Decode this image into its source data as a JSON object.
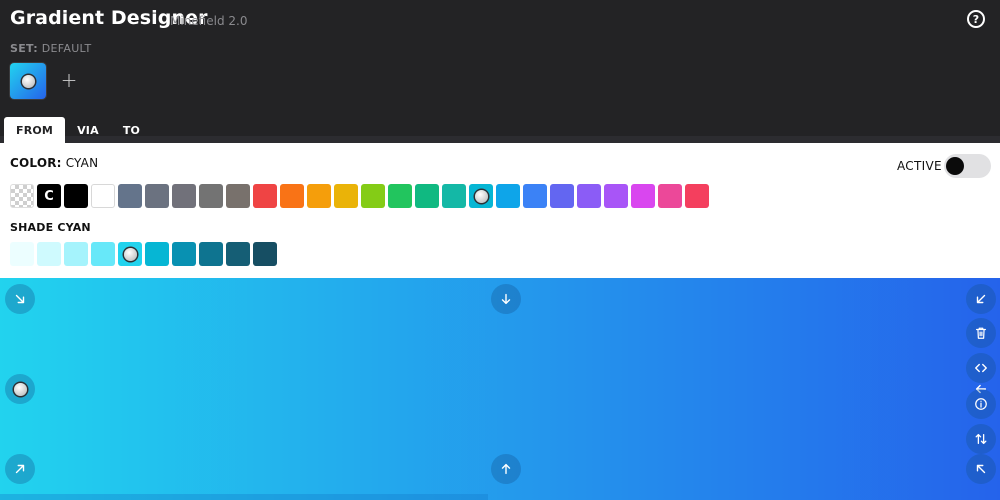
{
  "app": {
    "title": "Gradient Designer",
    "version": "Minefield 2.0"
  },
  "set": {
    "label": "SET:",
    "name": "DEFAULT"
  },
  "tabs": [
    {
      "label": "FROM",
      "active": true
    },
    {
      "label": "VIA",
      "active": false
    },
    {
      "label": "TO",
      "active": false
    }
  ],
  "color": {
    "label": "COLOR:",
    "name": "CYAN"
  },
  "active_toggle": {
    "label": "ACTIVE",
    "on": false
  },
  "palette": [
    {
      "name": "transparent",
      "hex": ""
    },
    {
      "name": "current",
      "hex": "#000000",
      "text": "C"
    },
    {
      "name": "black",
      "hex": "#000000"
    },
    {
      "name": "white",
      "hex": "#ffffff"
    },
    {
      "name": "slate",
      "hex": "#64748b"
    },
    {
      "name": "gray",
      "hex": "#6b7280"
    },
    {
      "name": "zinc",
      "hex": "#71717a"
    },
    {
      "name": "neutral",
      "hex": "#737373"
    },
    {
      "name": "stone",
      "hex": "#78716c"
    },
    {
      "name": "red",
      "hex": "#ef4444"
    },
    {
      "name": "orange",
      "hex": "#f97316"
    },
    {
      "name": "amber",
      "hex": "#f59e0b"
    },
    {
      "name": "yellow",
      "hex": "#eab308"
    },
    {
      "name": "lime",
      "hex": "#84cc16"
    },
    {
      "name": "green",
      "hex": "#22c55e"
    },
    {
      "name": "emerald",
      "hex": "#10b981"
    },
    {
      "name": "teal",
      "hex": "#14b8a6"
    },
    {
      "name": "cyan",
      "hex": "#06b6d4",
      "selected": true
    },
    {
      "name": "sky",
      "hex": "#0ea5e9"
    },
    {
      "name": "blue",
      "hex": "#3b82f6"
    },
    {
      "name": "indigo",
      "hex": "#6366f1"
    },
    {
      "name": "violet",
      "hex": "#8b5cf6"
    },
    {
      "name": "purple",
      "hex": "#a855f7"
    },
    {
      "name": "fuchsia",
      "hex": "#d946ef"
    },
    {
      "name": "pink",
      "hex": "#ec4899"
    },
    {
      "name": "rose",
      "hex": "#f43f5e"
    }
  ],
  "shade": {
    "label": "SHADE CYAN",
    "swatches": [
      {
        "name": "50",
        "hex": "#ecfeff"
      },
      {
        "name": "100",
        "hex": "#cffafe"
      },
      {
        "name": "200",
        "hex": "#a5f3fc"
      },
      {
        "name": "300",
        "hex": "#67e8f9"
      },
      {
        "name": "400",
        "hex": "#22d3ee",
        "selected": true
      },
      {
        "name": "500",
        "hex": "#06b6d4"
      },
      {
        "name": "600",
        "hex": "#0891b2"
      },
      {
        "name": "700",
        "hex": "#0e7490"
      },
      {
        "name": "800",
        "hex": "#155e75"
      },
      {
        "name": "900",
        "hex": "#164e63"
      }
    ]
  },
  "preview": {
    "from_color": "#22d3ee",
    "to_color": "#2563eb",
    "direction": "to right"
  },
  "icons": {
    "help": "?",
    "add": "+"
  }
}
